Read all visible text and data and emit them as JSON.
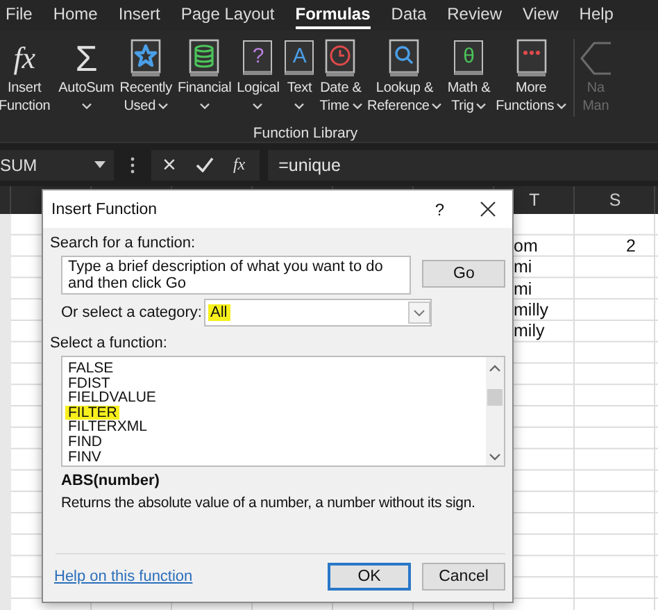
{
  "tabs": [
    {
      "label": "File",
      "selected": false
    },
    {
      "label": "Home",
      "selected": false
    },
    {
      "label": "Insert",
      "selected": false
    },
    {
      "label": "Page Layout",
      "selected": false
    },
    {
      "label": "Formulas",
      "selected": true
    },
    {
      "label": "Data",
      "selected": false
    },
    {
      "label": "Review",
      "selected": false
    },
    {
      "label": "View",
      "selected": false
    },
    {
      "label": "Help",
      "selected": false
    }
  ],
  "ribbon": {
    "group_label": "Function Library",
    "buttons": [
      {
        "kind": "fx",
        "glyph": "fx",
        "lines": [
          "Insert",
          "Function"
        ],
        "dropdown": false,
        "disabled": false
      },
      {
        "kind": "sigma",
        "glyph": "Σ",
        "lines": [
          "AutoSum"
        ],
        "dropdown": true,
        "disabled": false
      },
      {
        "kind": "book-star",
        "color": "#4a9fe8",
        "lines": [
          "Recently",
          "Used"
        ],
        "dropdown": true,
        "disabled": false
      },
      {
        "kind": "book-database",
        "color": "#4cc35a",
        "lines": [
          "Financial"
        ],
        "dropdown": true,
        "disabled": false
      },
      {
        "kind": "book-glyph",
        "glyph": "?",
        "color": "#b77fdc",
        "lines": [
          "Logical"
        ],
        "dropdown": true,
        "disabled": false
      },
      {
        "kind": "book-glyph",
        "glyph": "A",
        "color": "#4a9fe8",
        "lines": [
          "Text"
        ],
        "dropdown": true,
        "disabled": false
      },
      {
        "kind": "book-clock",
        "color": "#e04a4a",
        "lines": [
          "Date &",
          "Time"
        ],
        "dropdown": true,
        "disabled": false
      },
      {
        "kind": "book-search",
        "color": "#4a9fe8",
        "lines": [
          "Lookup &",
          "Reference"
        ],
        "dropdown": true,
        "disabled": false
      },
      {
        "kind": "book-glyph",
        "glyph": "θ",
        "color": "#4cc35a",
        "lines": [
          "Math &",
          "Trig"
        ],
        "dropdown": true,
        "disabled": false
      },
      {
        "kind": "book-dots",
        "color": "#e04a4a",
        "lines": [
          "More",
          "Functions"
        ],
        "dropdown": true,
        "disabled": false
      },
      {
        "kind": "tag",
        "lines": [
          "Na",
          "Man"
        ],
        "dropdown": false,
        "disabled": true
      }
    ]
  },
  "formula_bar": {
    "name_box": "SUM",
    "cancel_glyph": "×",
    "function_glyph": "fx",
    "formula": "=unique"
  },
  "sheet": {
    "column_headers": [
      {
        "label": "T"
      },
      {
        "label": "S"
      }
    ],
    "rows": [
      {
        "T": "om",
        "S": "2"
      },
      {
        "T": "mi"
      },
      {
        "T": "mi"
      },
      {
        "T": "milly"
      },
      {
        "T": "mily"
      }
    ]
  },
  "dialog": {
    "title": "Insert Function",
    "help_glyph": "?",
    "search_label": "Search for a function:",
    "search_value": "Type a brief description of what you want to do and then click Go",
    "go_button": "Go",
    "category_label": "Or select a category:",
    "category": {
      "value": "All",
      "highlighted": true
    },
    "list_label": "Select a function:",
    "functions": [
      {
        "name": "FALSE",
        "highlighted": false
      },
      {
        "name": "FDIST",
        "highlighted": false
      },
      {
        "name": "FIELDVALUE",
        "highlighted": false
      },
      {
        "name": "FILTER",
        "highlighted": true
      },
      {
        "name": "FILTERXML",
        "highlighted": false
      },
      {
        "name": "FIND",
        "highlighted": false
      },
      {
        "name": "FINV",
        "highlighted": false
      }
    ],
    "syntax": "ABS(number)",
    "description": "Returns the absolute value of a number, a number without its sign.",
    "help_link": "Help on this function",
    "ok_button": "OK",
    "cancel_button": "Cancel"
  }
}
